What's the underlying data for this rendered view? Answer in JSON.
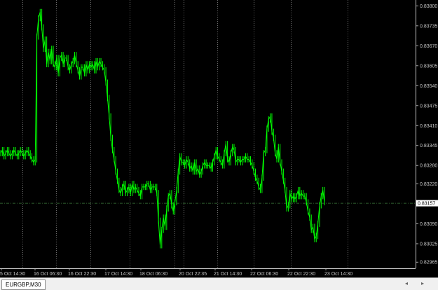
{
  "symbol_tab": "EURGBP,M30",
  "colors": {
    "background": "#000000",
    "candles": "#00ff00",
    "grid": "#b4b4b4",
    "current_price_line": "#3c7a3c",
    "axis_text": "#c8c8c8"
  },
  "icons": {
    "scroll_left": "triangle-left-icon",
    "scroll_right": "triangle-right-icon"
  },
  "scroll_left_glyph": "◂",
  "scroll_right_glyph": "▸",
  "chart_data": {
    "type": "candlestick",
    "symbol": "EURGBP",
    "timeframe": "M30",
    "y_ticks": [
      "0.83800",
      "0.83735",
      "0.83670",
      "0.83605",
      "0.83540",
      "0.83475",
      "0.83410",
      "0.83345",
      "0.83280",
      "0.83220",
      "0.83155",
      "0.83090",
      "0.83025",
      "0.82965"
    ],
    "ylim": [
      0.82945,
      0.8381
    ],
    "current_price": "0.83157",
    "x_ticks": [
      "5 Oct 14:30",
      "16 Oct 06:30",
      "16 Oct 22:30",
      "17 Oct 14:30",
      "18 Oct 06:30",
      "20 Oct 22:35",
      "21 Oct 14:30",
      "22 Oct 06:30",
      "22 Oct 22:30",
      "23 Oct 14:30"
    ],
    "x_tick_positions": [
      0,
      24.4,
      48.8,
      73.2,
      97.6,
      122,
      146.4,
      170.8,
      195.2,
      219.6
    ],
    "close_path": [
      [
        0,
        0.8332
      ],
      [
        1,
        0.8333
      ],
      [
        2,
        0.8331
      ],
      [
        3,
        0.8332
      ],
      [
        4,
        0.8333
      ],
      [
        5,
        0.8332
      ],
      [
        6,
        0.8331
      ],
      [
        7,
        0.8332
      ],
      [
        8,
        0.8333
      ],
      [
        9,
        0.8332
      ],
      [
        10,
        0.8331
      ],
      [
        11,
        0.8332
      ],
      [
        12,
        0.8333
      ],
      [
        13,
        0.8332
      ],
      [
        14,
        0.8331
      ],
      [
        15,
        0.8332
      ],
      [
        16,
        0.8333
      ],
      [
        17,
        0.8332
      ],
      [
        18,
        0.8331
      ],
      [
        19,
        0.833
      ],
      [
        20,
        0.8329
      ],
      [
        21,
        0.833
      ],
      [
        22,
        0.837
      ],
      [
        23,
        0.8376
      ],
      [
        24,
        0.8378
      ],
      [
        25,
        0.8373
      ],
      [
        26,
        0.8366
      ],
      [
        27,
        0.8369
      ],
      [
        28,
        0.8361
      ],
      [
        29,
        0.8365
      ],
      [
        30,
        0.8362
      ],
      [
        31,
        0.8366
      ],
      [
        32,
        0.8361
      ],
      [
        33,
        0.836
      ],
      [
        34,
        0.8363
      ],
      [
        35,
        0.8358
      ],
      [
        36,
        0.8363
      ],
      [
        37,
        0.8364
      ],
      [
        38,
        0.8361
      ],
      [
        39,
        0.8363
      ],
      [
        40,
        0.8363
      ],
      [
        41,
        0.836
      ],
      [
        42,
        0.8359
      ],
      [
        43,
        0.8361
      ],
      [
        44,
        0.8362
      ],
      [
        45,
        0.8364
      ],
      [
        46,
        0.8361
      ],
      [
        47,
        0.8359
      ],
      [
        48,
        0.8357
      ],
      [
        49,
        0.836
      ],
      [
        50,
        0.836
      ],
      [
        51,
        0.8358
      ],
      [
        52,
        0.8361
      ],
      [
        53,
        0.8359
      ],
      [
        54,
        0.8361
      ],
      [
        55,
        0.836
      ],
      [
        56,
        0.8361
      ],
      [
        57,
        0.8359
      ],
      [
        58,
        0.8362
      ],
      [
        59,
        0.836
      ],
      [
        60,
        0.8362
      ],
      [
        61,
        0.8361
      ],
      [
        62,
        0.836
      ],
      [
        63,
        0.8359
      ],
      [
        64,
        0.8355
      ],
      [
        65,
        0.835
      ],
      [
        66,
        0.8344
      ],
      [
        67,
        0.8337
      ],
      [
        68,
        0.8333
      ],
      [
        69,
        0.833
      ],
      [
        70,
        0.8326
      ],
      [
        71,
        0.8323
      ],
      [
        72,
        0.832
      ],
      [
        73,
        0.8319
      ],
      [
        74,
        0.8321
      ],
      [
        75,
        0.8322
      ],
      [
        76,
        0.8319
      ],
      [
        77,
        0.832
      ],
      [
        78,
        0.8321
      ],
      [
        79,
        0.8319
      ],
      [
        80,
        0.8322
      ],
      [
        81,
        0.832
      ],
      [
        82,
        0.8321
      ],
      [
        83,
        0.832
      ],
      [
        84,
        0.8319
      ],
      [
        85,
        0.8318
      ],
      [
        86,
        0.8321
      ],
      [
        87,
        0.8321
      ],
      [
        88,
        0.8321
      ],
      [
        89,
        0.8322
      ],
      [
        90,
        0.8322
      ],
      [
        91,
        0.832
      ],
      [
        92,
        0.8321
      ],
      [
        93,
        0.8321
      ],
      [
        94,
        0.8321
      ],
      [
        95,
        0.8319
      ],
      [
        96,
        0.831
      ],
      [
        97,
        0.8302
      ],
      [
        98,
        0.8307
      ],
      [
        99,
        0.8311
      ],
      [
        100,
        0.8308
      ],
      [
        101,
        0.8314
      ],
      [
        102,
        0.8318
      ],
      [
        103,
        0.8319
      ],
      [
        104,
        0.8315
      ],
      [
        105,
        0.8313
      ],
      [
        106,
        0.8316
      ],
      [
        107,
        0.832
      ],
      [
        108,
        0.8326
      ],
      [
        109,
        0.8331
      ],
      [
        110,
        0.8329
      ],
      [
        111,
        0.8329
      ],
      [
        112,
        0.8328
      ],
      [
        113,
        0.833
      ],
      [
        114,
        0.8329
      ],
      [
        115,
        0.8327
      ],
      [
        116,
        0.8328
      ],
      [
        117,
        0.8326
      ],
      [
        118,
        0.8329
      ],
      [
        119,
        0.8326
      ],
      [
        120,
        0.8327
      ],
      [
        121,
        0.8325
      ],
      [
        122,
        0.8326
      ],
      [
        123,
        0.8328
      ],
      [
        124,
        0.8329
      ],
      [
        125,
        0.8328
      ],
      [
        126,
        0.8328
      ],
      [
        127,
        0.8328
      ],
      [
        128,
        0.8327
      ],
      [
        129,
        0.8329
      ],
      [
        130,
        0.8331
      ],
      [
        131,
        0.8333
      ],
      [
        132,
        0.8331
      ],
      [
        133,
        0.833
      ],
      [
        134,
        0.8329
      ],
      [
        135,
        0.8328
      ],
      [
        136,
        0.8332
      ],
      [
        137,
        0.8335
      ],
      [
        138,
        0.833
      ],
      [
        139,
        0.8329
      ],
      [
        140,
        0.8332
      ],
      [
        141,
        0.8334
      ],
      [
        142,
        0.8333
      ],
      [
        143,
        0.8329
      ],
      [
        144,
        0.833
      ],
      [
        145,
        0.833
      ],
      [
        146,
        0.8329
      ],
      [
        147,
        0.833
      ],
      [
        148,
        0.833
      ],
      [
        149,
        0.8331
      ],
      [
        150,
        0.833
      ],
      [
        151,
        0.833
      ],
      [
        152,
        0.8329
      ],
      [
        153,
        0.8328
      ],
      [
        154,
        0.8326
      ],
      [
        155,
        0.8324
      ],
      [
        156,
        0.8323
      ],
      [
        157,
        0.8321
      ],
      [
        158,
        0.832
      ],
      [
        159,
        0.8324
      ],
      [
        160,
        0.8332
      ],
      [
        161,
        0.8333
      ],
      [
        162,
        0.834
      ],
      [
        163,
        0.8343
      ],
      [
        164,
        0.8344
      ],
      [
        165,
        0.8339
      ],
      [
        166,
        0.8337
      ],
      [
        167,
        0.8332
      ],
      [
        168,
        0.833
      ],
      [
        169,
        0.8334
      ],
      [
        170,
        0.8329
      ],
      [
        171,
        0.8326
      ],
      [
        172,
        0.8323
      ],
      [
        173,
        0.832
      ],
      [
        174,
        0.8314
      ],
      [
        175,
        0.8315
      ],
      [
        176,
        0.8319
      ],
      [
        177,
        0.8317
      ],
      [
        178,
        0.8318
      ],
      [
        179,
        0.8317
      ],
      [
        180,
        0.8318
      ],
      [
        181,
        0.832
      ],
      [
        182,
        0.8318
      ],
      [
        183,
        0.8319
      ],
      [
        184,
        0.8318
      ],
      [
        185,
        0.8318
      ],
      [
        186,
        0.8316
      ],
      [
        187,
        0.8313
      ],
      [
        188,
        0.8311
      ],
      [
        189,
        0.8307
      ],
      [
        190,
        0.8308
      ],
      [
        191,
        0.8304
      ],
      [
        192,
        0.8305
      ],
      [
        193,
        0.8309
      ],
      [
        194,
        0.8315
      ],
      [
        195,
        0.8318
      ],
      [
        196,
        0.832
      ],
      [
        197,
        0.8316
      ]
    ]
  }
}
